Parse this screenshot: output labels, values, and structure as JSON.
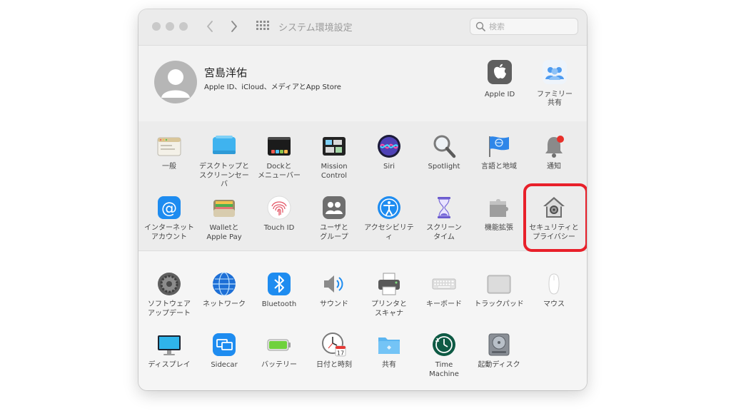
{
  "window": {
    "title": "システム環境設定",
    "search_placeholder": "検索"
  },
  "account": {
    "name": "宮島洋佑",
    "subtitle": "Apple ID、iCloud、メディアとApp Store",
    "items": [
      {
        "label": "Apple ID",
        "icon": "apple-icon"
      },
      {
        "label": "ファミリー\n共有",
        "icon": "family-icon"
      }
    ]
  },
  "section1": {
    "items": [
      {
        "label": "一般",
        "icon": "general-icon"
      },
      {
        "label": "デスクトップと\nスクリーンセーバ",
        "icon": "desktop-icon"
      },
      {
        "label": "Dockと\nメニューバー",
        "icon": "dock-icon"
      },
      {
        "label": "Mission\nControl",
        "icon": "mission-control-icon"
      },
      {
        "label": "Siri",
        "icon": "siri-icon"
      },
      {
        "label": "Spotlight",
        "icon": "spotlight-icon"
      },
      {
        "label": "言語と地域",
        "icon": "flag-icon"
      },
      {
        "label": "通知",
        "icon": "bell-icon"
      },
      {
        "label": "インターネット\nアカウント",
        "icon": "at-icon"
      },
      {
        "label": "Walletと\nApple Pay",
        "icon": "wallet-icon"
      },
      {
        "label": "Touch ID",
        "icon": "fingerprint-icon"
      },
      {
        "label": "ユーザと\nグループ",
        "icon": "users-icon"
      },
      {
        "label": "アクセシビリティ",
        "icon": "accessibility-icon"
      },
      {
        "label": "スクリーン\nタイム",
        "icon": "hourglass-icon"
      },
      {
        "label": "機能拡張",
        "icon": "puzzle-icon"
      },
      {
        "label": "セキュリティと\nプライバシー",
        "icon": "security-house-icon"
      }
    ]
  },
  "section2": {
    "items": [
      {
        "label": "ソフトウェア\nアップデート",
        "icon": "gear-icon"
      },
      {
        "label": "ネットワーク",
        "icon": "globe-icon"
      },
      {
        "label": "Bluetooth",
        "icon": "bluetooth-icon"
      },
      {
        "label": "サウンド",
        "icon": "speaker-icon"
      },
      {
        "label": "プリンタと\nスキャナ",
        "icon": "printer-icon"
      },
      {
        "label": "キーボード",
        "icon": "keyboard-icon"
      },
      {
        "label": "トラックパッド",
        "icon": "trackpad-icon"
      },
      {
        "label": "マウス",
        "icon": "mouse-icon"
      },
      {
        "label": "ディスプレイ",
        "icon": "display-icon"
      },
      {
        "label": "Sidecar",
        "icon": "sidecar-icon"
      },
      {
        "label": "バッテリー",
        "icon": "battery-icon"
      },
      {
        "label": "日付と時刻",
        "icon": "clock-icon"
      },
      {
        "label": "共有",
        "icon": "folder-icon"
      },
      {
        "label": "Time\nMachine",
        "icon": "time-machine-icon"
      },
      {
        "label": "起動ディスク",
        "icon": "disk-icon"
      }
    ]
  },
  "date_icon_day": "17",
  "colors": {
    "highlight": "#e8202a",
    "window_bg": "#ebebeb",
    "accent_blue": "#1e8cf0"
  }
}
